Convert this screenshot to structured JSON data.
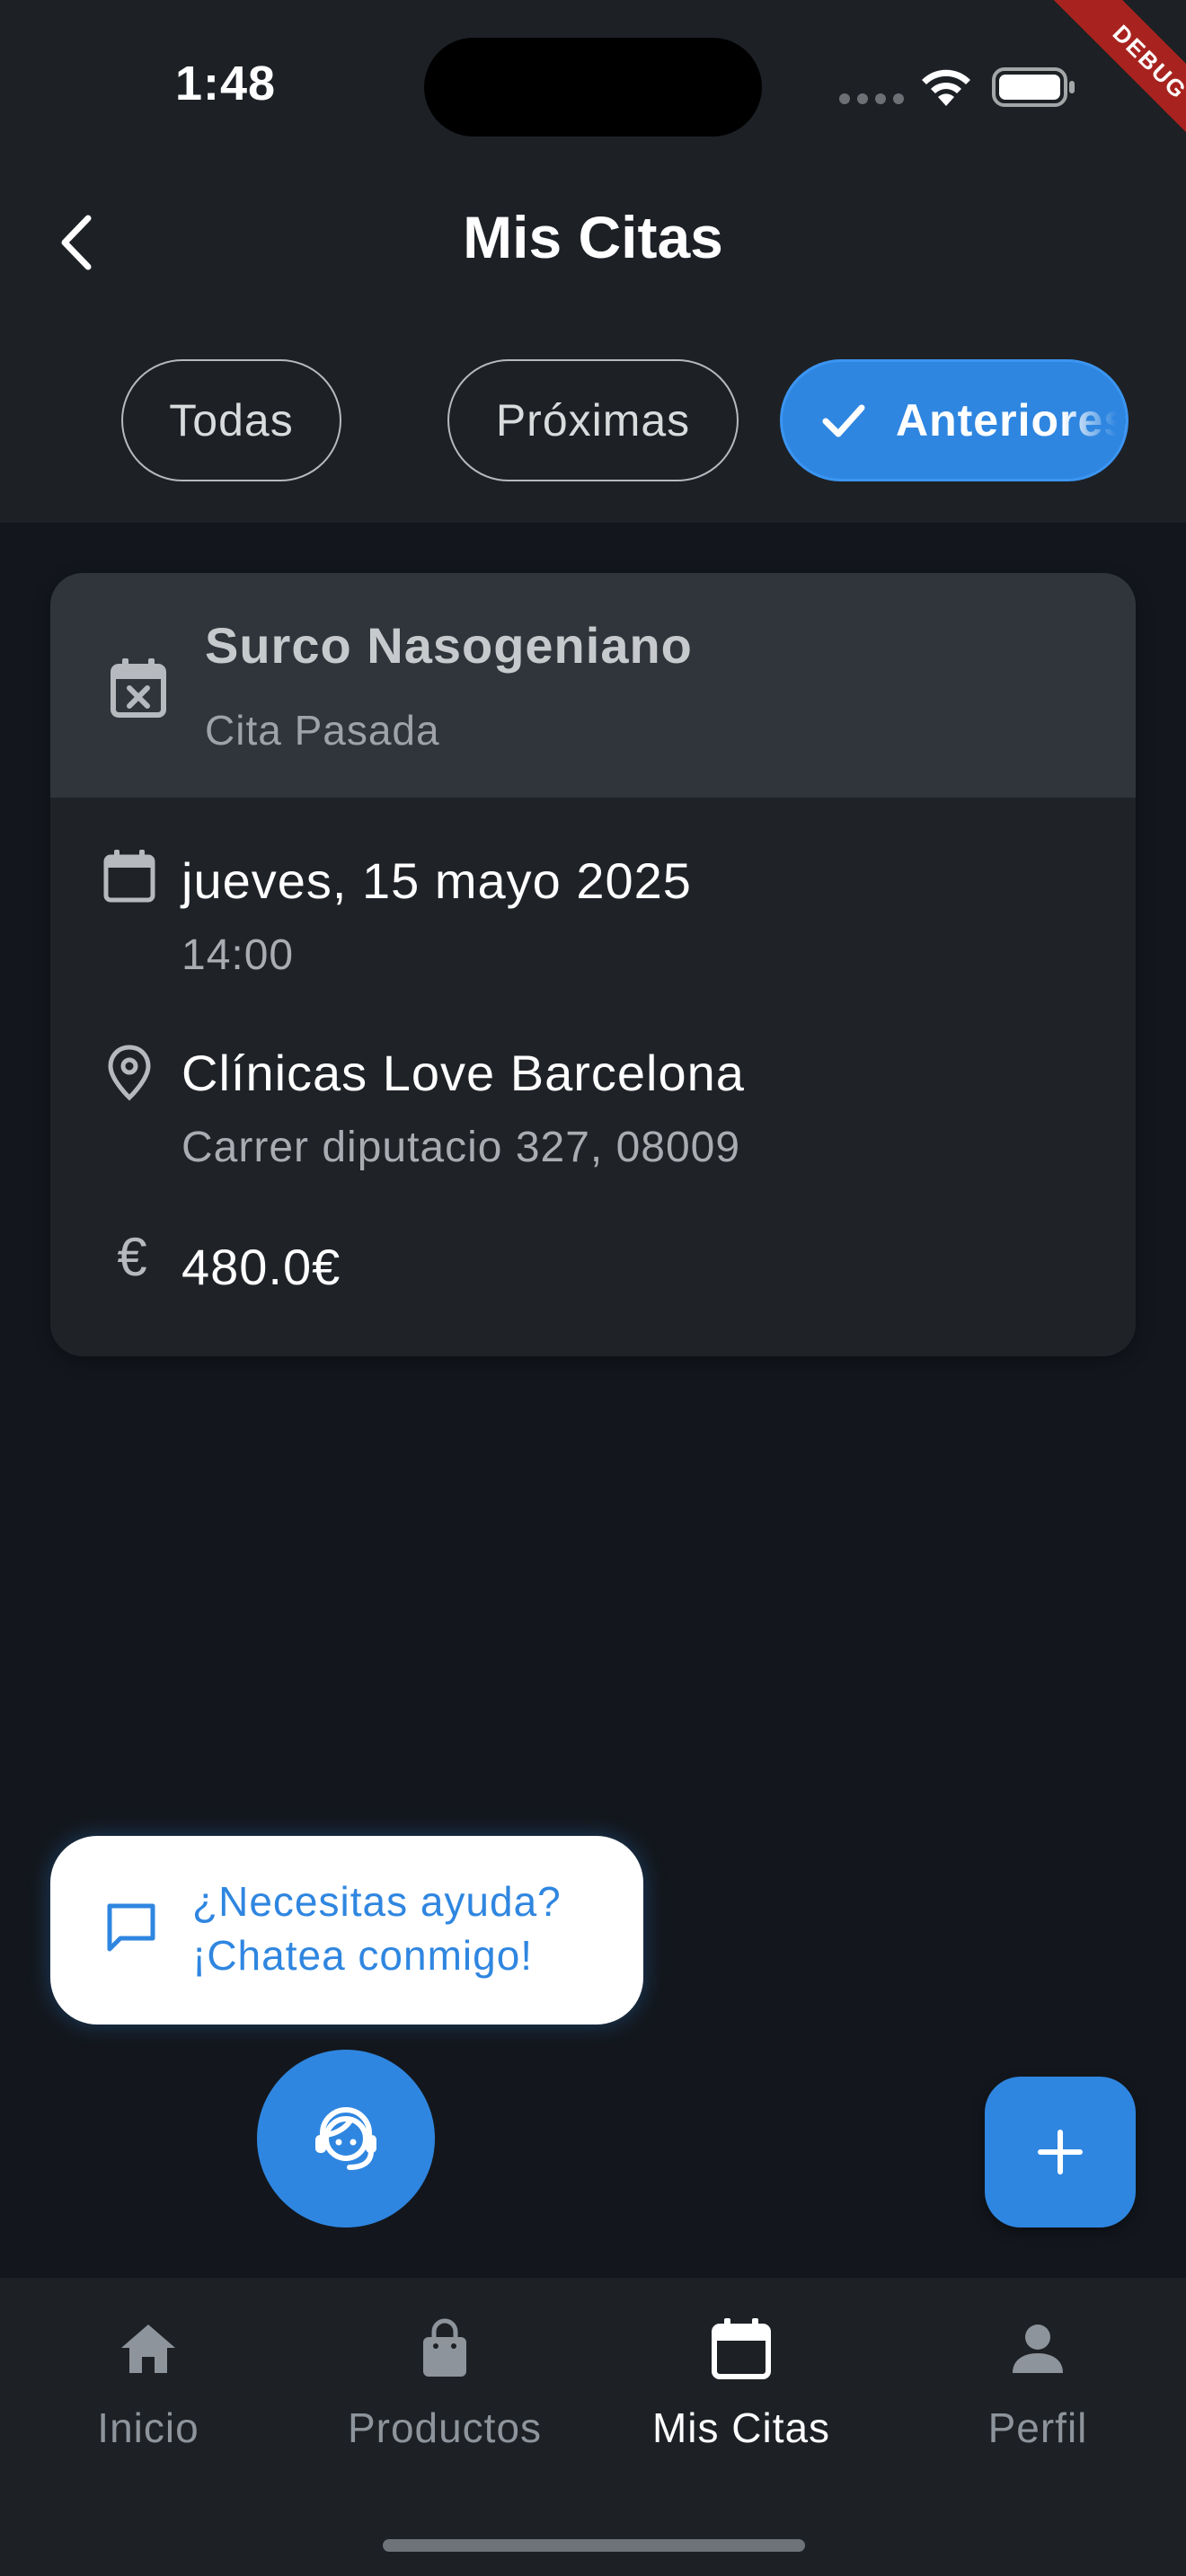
{
  "status_bar": {
    "time": "1:48"
  },
  "debug_banner": "DEBUG",
  "app_bar": {
    "title": "Mis Citas"
  },
  "filters": [
    {
      "label": "Todas",
      "selected": false
    },
    {
      "label": "Próximas",
      "selected": false
    },
    {
      "label": "Anteriores",
      "selected": true
    }
  ],
  "appointment": {
    "title": "Surco Nasogeniano",
    "status": "Cita Pasada",
    "date": "jueves, 15 mayo 2025",
    "time": "14:00",
    "clinic_name": "Clínicas Love Barcelona",
    "clinic_address": "Carrer diputacio 327, 08009",
    "price": "480.0€",
    "currency_symbol": "€"
  },
  "help_bubble": {
    "line1": "¿Necesitas ayuda?",
    "line2": "¡Chatea conmigo!"
  },
  "bottom_nav": {
    "items": [
      {
        "label": "Inicio",
        "icon": "home-icon",
        "active": false
      },
      {
        "label": "Productos",
        "icon": "shopping-bag-icon",
        "active": false
      },
      {
        "label": "Mis Citas",
        "icon": "calendar-icon",
        "active": true
      },
      {
        "label": "Perfil",
        "icon": "person-icon",
        "active": false
      }
    ]
  },
  "colors": {
    "accent": "#2f86e0",
    "background": "#13171d",
    "surface": "#1d2126",
    "card": "#1f2328",
    "card_header": "#30353b",
    "debug_ribbon": "#a8231f"
  }
}
